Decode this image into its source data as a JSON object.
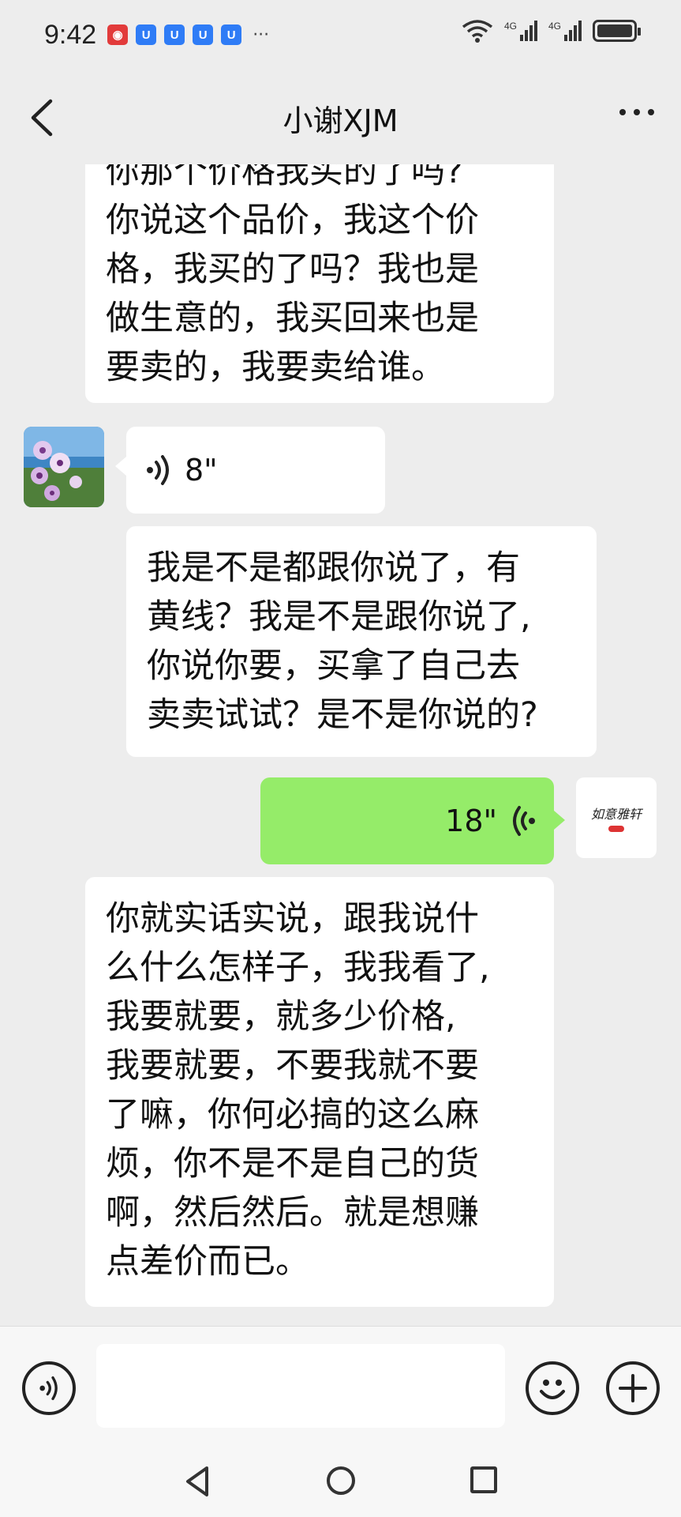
{
  "status_bar": {
    "time": "9:42",
    "notif_icons": [
      "app-red-icon",
      "shield-blue-icon",
      "shield-blue-icon",
      "shield-blue-icon",
      "shield-blue-icon"
    ],
    "more": "···",
    "network_1": "4G",
    "network_2": "4G"
  },
  "header": {
    "title": "小谢XJM"
  },
  "messages": [
    {
      "type": "text",
      "side": "left",
      "text": "你那个价格我买的了吗?\n你说这个品价，我这个价\n格，我买的了吗？我也是\n做生意的，我买回来也是\n要卖的，我要卖给谁。"
    },
    {
      "type": "voice",
      "side": "left",
      "duration": "8\""
    },
    {
      "type": "text",
      "side": "left",
      "text": "我是不是都跟你说了，有\n黄线？我是不是跟你说了,\n你说你要，买拿了自己去\n卖卖试试？是不是你说的?"
    },
    {
      "type": "voice",
      "side": "right",
      "duration": "18\""
    },
    {
      "type": "text",
      "side": "left",
      "text": "你就实话实说，跟我说什\n么什么怎样子，我我看了,\n我要就要，就多少价格,\n我要就要，不要我就不要\n了嘛，你何必搞的这么麻\n烦，你不是不是自己的货\n啊，然后然后。就是想赚\n点差价而已。"
    }
  ],
  "my_avatar_text": "如意雅轩",
  "colors": {
    "background": "#ededed",
    "bubble_received": "#ffffff",
    "bubble_sent": "#95ec69"
  }
}
